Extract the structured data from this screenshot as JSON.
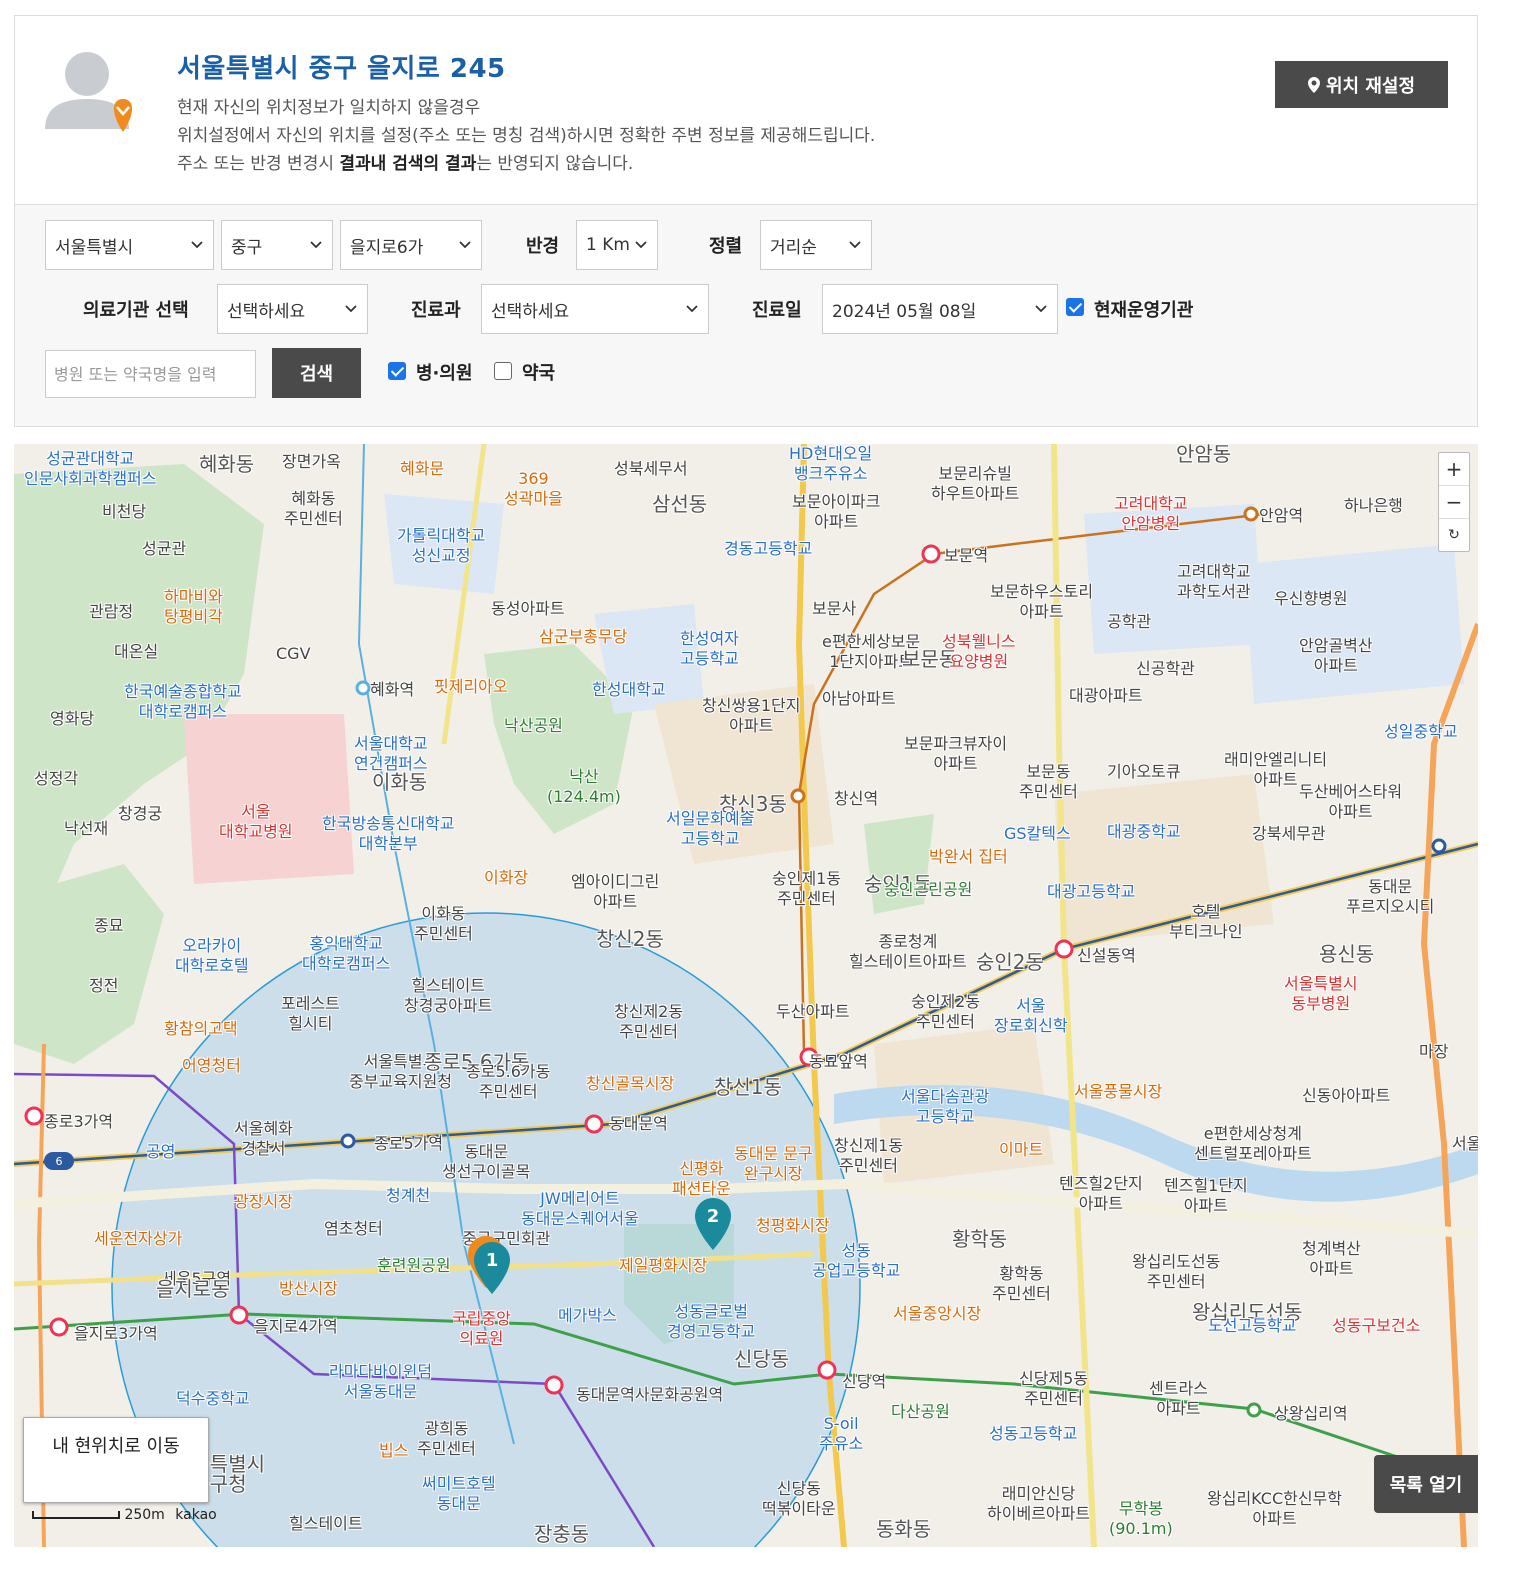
{
  "header": {
    "address": "서울특별시 중구 을지로 245",
    "desc_line1": "현재 자신의 위치정보가 일치하지 않을경우",
    "desc_line2": "위치설정에서 자신의 위치를 설정(주소 또는 명칭 검색)하시면 정확한 주변 정보를 제공해드립니다.",
    "desc_line3_pre": "주소 또는 반경 변경시 ",
    "desc_line3_bold": "결과내 검색의 결과",
    "desc_line3_post": "는 반영되지 않습니다.",
    "reset_button": "위치 재설정"
  },
  "filters": {
    "city": "서울특별시",
    "district": "중구",
    "dong": "을지로6가",
    "radius_label": "반경",
    "radius": "1 Km",
    "sort_label": "정렬",
    "sort": "거리순",
    "institution_label": "의료기관 선택",
    "institution": "선택하세요",
    "department_label": "진료과",
    "department": "선택하세요",
    "date_label": "진료일",
    "date": "2024년 05월 08일",
    "operating_label": "현재운영기관",
    "operating_checked": true,
    "search_placeholder": "병원 또는 약국명을 입력",
    "search_button": "검색",
    "hospital_label": "병·의원",
    "hospital_checked": true,
    "pharmacy_label": "약국",
    "pharmacy_checked": false
  },
  "map": {
    "zoom_in": "+",
    "zoom_out": "−",
    "reset": "↻",
    "my_location_button": "내 현위치로 이동",
    "list_button": "목록 열기",
    "scale": "250m",
    "provider": "kakao",
    "markers": [
      {
        "label": "1",
        "color": "#1a8a9c"
      },
      {
        "label": "2",
        "color": "#1a8a9c"
      }
    ],
    "labels": [
      {
        "text": "성균관대학교\n인문사회과학캠퍼스",
        "cls": "blue"
      },
      {
        "text": "혜화동",
        "cls": "big"
      },
      {
        "text": "장면가옥",
        "cls": ""
      },
      {
        "text": "혜화문",
        "cls": "orange"
      },
      {
        "text": "369\n성곽마을",
        "cls": "orange"
      },
      {
        "text": "성북세무서",
        "cls": ""
      },
      {
        "text": "HD현대오일\n뱅크주유소",
        "cls": "blue"
      },
      {
        "text": "보문리슈빌\n하우트아파트",
        "cls": ""
      },
      {
        "text": "안암동",
        "cls": "big"
      },
      {
        "text": "고려대학교\n안암병원",
        "cls": "red"
      },
      {
        "text": "안암역",
        "cls": ""
      },
      {
        "text": "하나은행",
        "cls": ""
      },
      {
        "text": "비천당",
        "cls": ""
      },
      {
        "text": "혜화동\n주민센터",
        "cls": ""
      },
      {
        "text": "가톨릭대학교\n성신교정",
        "cls": "blue"
      },
      {
        "text": "삼선동",
        "cls": "big"
      },
      {
        "text": "보문아이파크\n아파트",
        "cls": ""
      },
      {
        "text": "경동고등학교",
        "cls": "blue"
      },
      {
        "text": "보문역",
        "cls": ""
      },
      {
        "text": "고려대학교\n과학도서관",
        "cls": ""
      },
      {
        "text": "우신향병원",
        "cls": ""
      },
      {
        "text": "성균관",
        "cls": ""
      },
      {
        "text": "하마비와\n탕평비각",
        "cls": "orange"
      },
      {
        "text": "관람정",
        "cls": ""
      },
      {
        "text": "동성아파트",
        "cls": ""
      },
      {
        "text": "삼군부총무당",
        "cls": "orange"
      },
      {
        "text": "한성여자\n고등학교",
        "cls": "blue"
      },
      {
        "text": "보문사",
        "cls": ""
      },
      {
        "text": "보문하우스토리\n아파트",
        "cls": ""
      },
      {
        "text": "공학관",
        "cls": ""
      },
      {
        "text": "안암골벽산\n아파트",
        "cls": ""
      },
      {
        "text": "대온실",
        "cls": ""
      },
      {
        "text": "CGV",
        "cls": ""
      },
      {
        "text": "e편한세상보문\n1단지아파트",
        "cls": ""
      },
      {
        "text": "보문동",
        "cls": "big"
      },
      {
        "text": "성북웰니스\n요양병원",
        "cls": "red"
      },
      {
        "text": "신공학관",
        "cls": ""
      },
      {
        "text": "대광아파트",
        "cls": ""
      },
      {
        "text": "한국예술종합학교\n대학로캠퍼스",
        "cls": "blue"
      },
      {
        "text": "혜화역",
        "cls": ""
      },
      {
        "text": "핏제리아오",
        "cls": "orange"
      },
      {
        "text": "한성대학교",
        "cls": "blue"
      },
      {
        "text": "창신쌍용1단지\n아파트",
        "cls": ""
      },
      {
        "text": "아남아파트",
        "cls": ""
      },
      {
        "text": "영화당",
        "cls": ""
      },
      {
        "text": "낙산공원",
        "cls": "green"
      },
      {
        "text": "성일중학교",
        "cls": "blue"
      },
      {
        "text": "서울대학교\n연건캠퍼스",
        "cls": "blue"
      },
      {
        "text": "보문파크뷰자이\n아파트",
        "cls": ""
      },
      {
        "text": "래미안엘리니티\n아파트",
        "cls": ""
      },
      {
        "text": "성정각",
        "cls": ""
      },
      {
        "text": "이화동",
        "cls": "big"
      },
      {
        "text": "낙산\n(124.4m)",
        "cls": "green"
      },
      {
        "text": "보문동\n주민센터",
        "cls": ""
      },
      {
        "text": "기아오토큐",
        "cls": ""
      },
      {
        "text": "두산베어스타워\n아파트",
        "cls": ""
      },
      {
        "text": "창경궁",
        "cls": ""
      },
      {
        "text": "서울\n대학교병원",
        "cls": "red"
      },
      {
        "text": "창신역",
        "cls": ""
      },
      {
        "text": "창신3동",
        "cls": "big"
      },
      {
        "text": "낙선재",
        "cls": ""
      },
      {
        "text": "한국방송통신대학교\n대학본부",
        "cls": "blue"
      },
      {
        "text": "서일문화예술\n고등학교",
        "cls": "blue"
      },
      {
        "text": "GS칼텍스",
        "cls": "blue"
      },
      {
        "text": "대광중학교",
        "cls": "blue"
      },
      {
        "text": "강북세무관",
        "cls": ""
      },
      {
        "text": "박완서 집터",
        "cls": "orange"
      },
      {
        "text": "이화장",
        "cls": "orange"
      },
      {
        "text": "엠아이디그린\n아파트",
        "cls": ""
      },
      {
        "text": "숭인제1동\n주민센터",
        "cls": ""
      },
      {
        "text": "숭인1동",
        "cls": "big"
      },
      {
        "text": "숭인근린공원",
        "cls": "green"
      },
      {
        "text": "대광고등학교",
        "cls": "blue"
      },
      {
        "text": "동대문\n푸르지오시티",
        "cls": ""
      },
      {
        "text": "호텔\n부티크나인",
        "cls": ""
      },
      {
        "text": "이화동\n주민센터",
        "cls": ""
      },
      {
        "text": "종묘",
        "cls": ""
      },
      {
        "text": "오라카이\n대학로호텔",
        "cls": "blue"
      },
      {
        "text": "홍익대학교\n대학로캠퍼스",
        "cls": "blue"
      },
      {
        "text": "창신2동",
        "cls": "big"
      },
      {
        "text": "종로청계\n힐스테이트아파트",
        "cls": ""
      },
      {
        "text": "숭인2동",
        "cls": "big"
      },
      {
        "text": "신설동역",
        "cls": ""
      },
      {
        "text": "용신동",
        "cls": "big"
      },
      {
        "text": "서울특별시\n동부병원",
        "cls": "red"
      },
      {
        "text": "정전",
        "cls": ""
      },
      {
        "text": "힐스테이트\n창경궁아파트",
        "cls": ""
      },
      {
        "text": "포레스트\n힐시티",
        "cls": ""
      },
      {
        "text": "창신제2동\n주민센터",
        "cls": ""
      },
      {
        "text": "두산아파트",
        "cls": ""
      },
      {
        "text": "숭인제2동\n주민센터",
        "cls": ""
      },
      {
        "text": "서울\n장로회신학",
        "cls": "blue"
      },
      {
        "text": "황참의고택",
        "cls": "orange"
      },
      {
        "text": "동묘앞역",
        "cls": ""
      },
      {
        "text": "마장",
        "cls": ""
      },
      {
        "text": "어영청터",
        "cls": "orange"
      },
      {
        "text": "서울특별시\n중부교육지원청",
        "cls": ""
      },
      {
        "text": "종로5.6가동",
        "cls": "big"
      },
      {
        "text": "종로5.6가동\n주민센터",
        "cls": ""
      },
      {
        "text": "창신골목시장",
        "cls": "orange"
      },
      {
        "text": "창신1동",
        "cls": "big"
      },
      {
        "text": "서울풍물시장",
        "cls": "orange"
      },
      {
        "text": "신동아아파트",
        "cls": ""
      },
      {
        "text": "종로3가역",
        "cls": ""
      },
      {
        "text": "서울혜화\n경찰서",
        "cls": ""
      },
      {
        "text": "서울다솜관광\n고등학교",
        "cls": "blue"
      },
      {
        "text": "공영",
        "cls": "blue"
      },
      {
        "text": "종로5가역",
        "cls": ""
      },
      {
        "text": "동대문\n생선구이골목",
        "cls": ""
      },
      {
        "text": "동대문역",
        "cls": ""
      },
      {
        "text": "동대문 문구\n완구시장",
        "cls": "orange"
      },
      {
        "text": "창신제1동\n주민센터",
        "cls": ""
      },
      {
        "text": "이마트",
        "cls": "orange"
      },
      {
        "text": "e편한세상청계\n센트럴포레아파트",
        "cls": ""
      },
      {
        "text": "서울숲",
        "cls": ""
      },
      {
        "text": "광장시장",
        "cls": "orange"
      },
      {
        "text": "신평화\n패션타운",
        "cls": "orange"
      },
      {
        "text": "청계천",
        "cls": "blue"
      },
      {
        "text": "JW메리어트\n동대문스퀘어서울",
        "cls": "blue"
      },
      {
        "text": "텐즈힐2단지\n아파트",
        "cls": ""
      },
      {
        "text": "텐즈힐1단지\n아파트",
        "cls": ""
      },
      {
        "text": "세운전자상가",
        "cls": "orange"
      },
      {
        "text": "염초청터",
        "cls": ""
      },
      {
        "text": "중구구민회관",
        "cls": ""
      },
      {
        "text": "청평화시장",
        "cls": "orange"
      },
      {
        "text": "성동\n공업고등학교",
        "cls": "blue"
      },
      {
        "text": "황학동",
        "cls": "big"
      },
      {
        "text": "왕십리도선동\n주민센터",
        "cls": ""
      },
      {
        "text": "청계벽산\n아파트",
        "cls": ""
      },
      {
        "text": "세운5구역",
        "cls": ""
      },
      {
        "text": "을지로동",
        "cls": "big"
      },
      {
        "text": "훈련원공원",
        "cls": "green"
      },
      {
        "text": "제일평화시장",
        "cls": "orange"
      },
      {
        "text": "황학동\n주민센터",
        "cls": ""
      },
      {
        "text": "방산시장",
        "cls": "orange"
      },
      {
        "text": "서울중앙시장",
        "cls": "orange"
      },
      {
        "text": "왕십리도선동",
        "cls": "big"
      },
      {
        "text": "도선고등학교",
        "cls": "blue"
      },
      {
        "text": "성동구보건소",
        "cls": "red"
      },
      {
        "text": "을지로3가역",
        "cls": ""
      },
      {
        "text": "을지로4가역",
        "cls": ""
      },
      {
        "text": "국립중앙\n의료원",
        "cls": "red"
      },
      {
        "text": "메가박스",
        "cls": "blue"
      },
      {
        "text": "성동글로벌\n경영고등학교",
        "cls": "blue"
      },
      {
        "text": "신당동",
        "cls": "big"
      },
      {
        "text": "라마다바이윈덤\n서울동대문",
        "cls": "blue"
      },
      {
        "text": "신당역",
        "cls": ""
      },
      {
        "text": "신당제5동\n주민센터",
        "cls": ""
      },
      {
        "text": "센트라스\n아파트",
        "cls": ""
      },
      {
        "text": "상왕십리역",
        "cls": ""
      },
      {
        "text": "덕수중학교",
        "cls": "blue"
      },
      {
        "text": "동대문역사문화공원역",
        "cls": ""
      },
      {
        "text": "광희동\n주민센터",
        "cls": ""
      },
      {
        "text": "S-oil\n주유소",
        "cls": "blue"
      },
      {
        "text": "다산공원",
        "cls": "green"
      },
      {
        "text": "성동고등학교",
        "cls": "blue"
      },
      {
        "text": "빕스",
        "cls": "orange"
      },
      {
        "text": "서울특별시\n중구청",
        "cls": "big"
      },
      {
        "text": "써미트호텔\n동대문",
        "cls": "blue"
      },
      {
        "text": "신당동\n떡볶이타운",
        "cls": ""
      },
      {
        "text": "래미안신당\n하이베르아파트",
        "cls": ""
      },
      {
        "text": "왕십리KCC한신무학\n아파트",
        "cls": ""
      },
      {
        "text": "무학봉\n(90.1m)",
        "cls": "green"
      },
      {
        "text": "힐스테이트",
        "cls": ""
      },
      {
        "text": "장충동",
        "cls": "big"
      },
      {
        "text": "동화동",
        "cls": "big"
      }
    ]
  }
}
